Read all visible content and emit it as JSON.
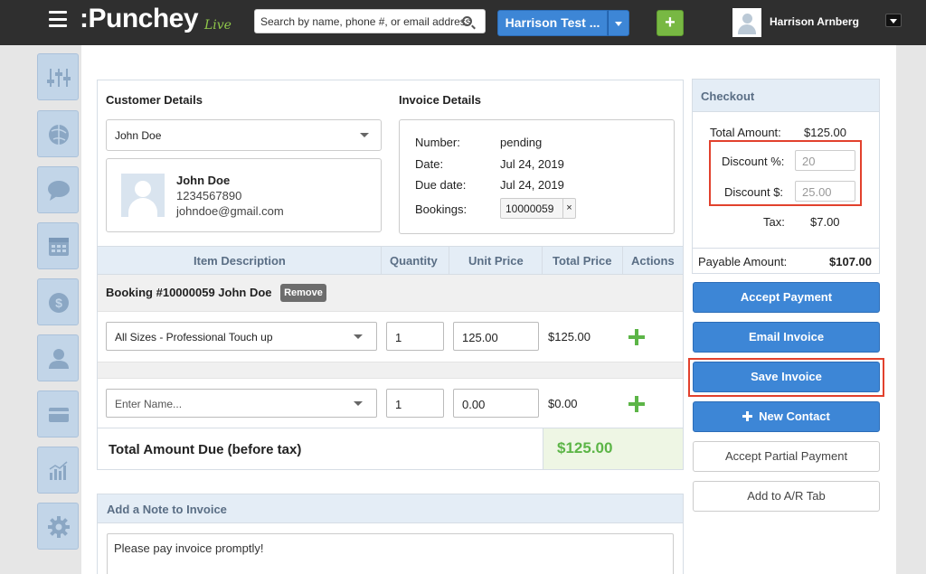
{
  "app": {
    "logo": ":Punchey",
    "logo_suffix": "Live"
  },
  "topbar": {
    "search_placeholder": "Search by name, phone #, or email address",
    "business_name": "Harrison Test ...",
    "add_label": "+",
    "user_name": "Harrison Arnberg"
  },
  "customer": {
    "title": "Customer Details",
    "selected": "John Doe",
    "name": "John Doe",
    "phone": "1234567890",
    "email": "johndoe@gmail.com"
  },
  "invoice": {
    "title": "Invoice Details",
    "rows": [
      {
        "label": "Number:",
        "value": "pending"
      },
      {
        "label": "Date:",
        "value": "Jul 24, 2019"
      },
      {
        "label": "Due date:",
        "value": "Jul 24, 2019"
      }
    ],
    "bookings_label": "Bookings:",
    "booking_tag": "10000059",
    "booking_tag_remove": "×"
  },
  "items_table": {
    "headers": [
      "Item Description",
      "Quantity",
      "Unit Price",
      "Total Price",
      "Actions"
    ],
    "booking_header": "Booking #10000059 John Doe",
    "remove_label": "Remove",
    "rows": [
      {
        "description": "All Sizes - Professional Touch up",
        "quantity": "1",
        "unit_price": "125.00",
        "total": "$125.00"
      },
      {
        "description_placeholder": "Enter Name...",
        "quantity": "1",
        "unit_price": "0.00",
        "total": "$0.00"
      }
    ],
    "total_label": "Total Amount Due (before tax)",
    "total_value": "$125.00"
  },
  "note": {
    "title": "Add a Note to Invoice",
    "value": "Please pay invoice promptly!"
  },
  "checkout": {
    "title": "Checkout",
    "total_label": "Total Amount:",
    "total_value": "$125.00",
    "discount_pct_label": "Discount %:",
    "discount_pct_placeholder": "20",
    "discount_amt_label": "Discount $:",
    "discount_amt_placeholder": "25.00",
    "tax_label": "Tax:",
    "tax_value": "$7.00",
    "payable_label": "Payable Amount:",
    "payable_value": "$107.00"
  },
  "actions": {
    "accept_payment": "Accept Payment",
    "email_invoice": "Email Invoice",
    "save_invoice": "Save Invoice",
    "new_contact": "New Contact",
    "accept_partial": "Accept Partial Payment",
    "add_ar_tab": "Add to A/R Tab"
  },
  "sidebar": {
    "icons": [
      "sliders-icon",
      "globe-icon",
      "chat-icon",
      "calendar-icon",
      "dollar-icon",
      "user-icon",
      "card-icon",
      "chart-icon",
      "gear-icon"
    ]
  },
  "colors": {
    "accent_blue": "#3d86d6",
    "green": "#5cb547",
    "highlight_red": "#e2412d",
    "header_dark": "#2f2f2f"
  }
}
